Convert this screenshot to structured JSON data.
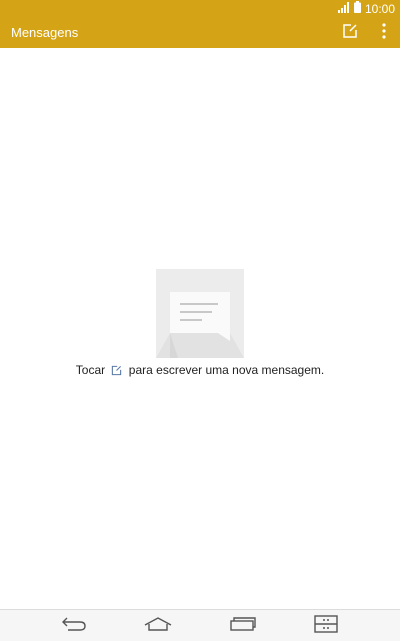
{
  "status_bar": {
    "time": "10:00",
    "icons": [
      "signal-icon",
      "battery-icon"
    ]
  },
  "app_bar": {
    "title": "Mensagens",
    "actions": [
      "compose-icon",
      "more-vert-icon"
    ]
  },
  "empty_state": {
    "text_before": "Tocar",
    "text_after": "para escrever uma nova mensagem.",
    "illustration": "message-illustration"
  },
  "nav_bar": {
    "buttons": [
      "back-icon",
      "home-icon",
      "recent-apps-icon",
      "dual-window-icon"
    ]
  },
  "colors": {
    "accent": "#d4a416",
    "background": "#ffffff"
  }
}
